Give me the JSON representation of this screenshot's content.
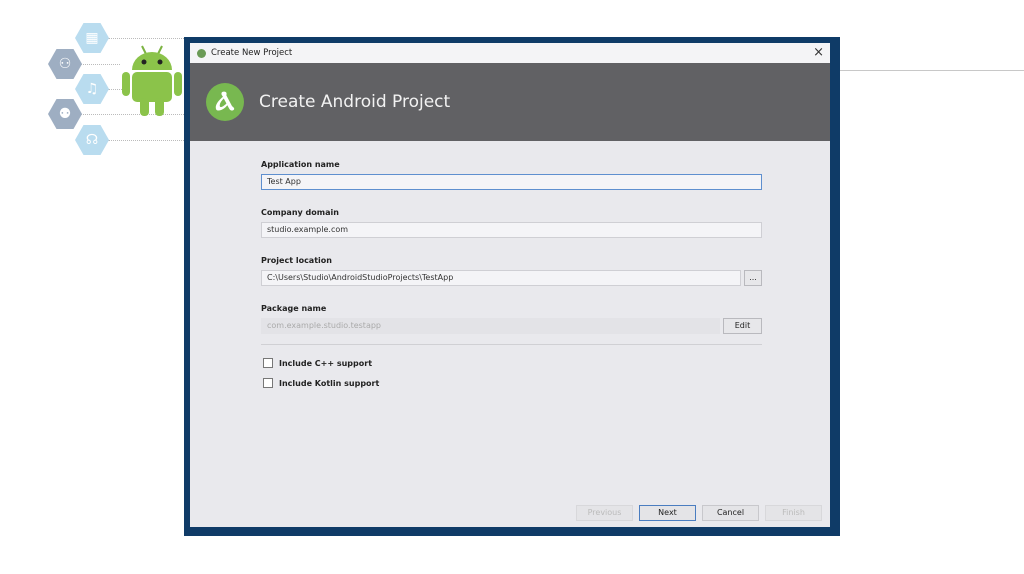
{
  "window": {
    "title": "Create New Project",
    "close_icon": "×"
  },
  "header": {
    "title": "Create Android Project"
  },
  "form": {
    "app_name": {
      "label": "Application name",
      "value": "Test App"
    },
    "company_domain": {
      "label": "Company domain",
      "value": "studio.example.com"
    },
    "project_location": {
      "label": "Project location",
      "value": "C:\\Users\\Studio\\AndroidStudioProjects\\TestApp",
      "browse_label": "..."
    },
    "package_name": {
      "label": "Package name",
      "value": "com.example.studio.testapp",
      "edit_label": "Edit"
    },
    "include_cpp": {
      "label": "Include C++ support",
      "checked": false
    },
    "include_kotlin": {
      "label": "Include Kotlin support",
      "checked": false
    }
  },
  "footer": {
    "previous": "Previous",
    "next": "Next",
    "cancel": "Cancel",
    "finish": "Finish"
  },
  "colors": {
    "header_bg": "#616164",
    "android_green": "#78b850",
    "frame": "#0f3b67"
  }
}
